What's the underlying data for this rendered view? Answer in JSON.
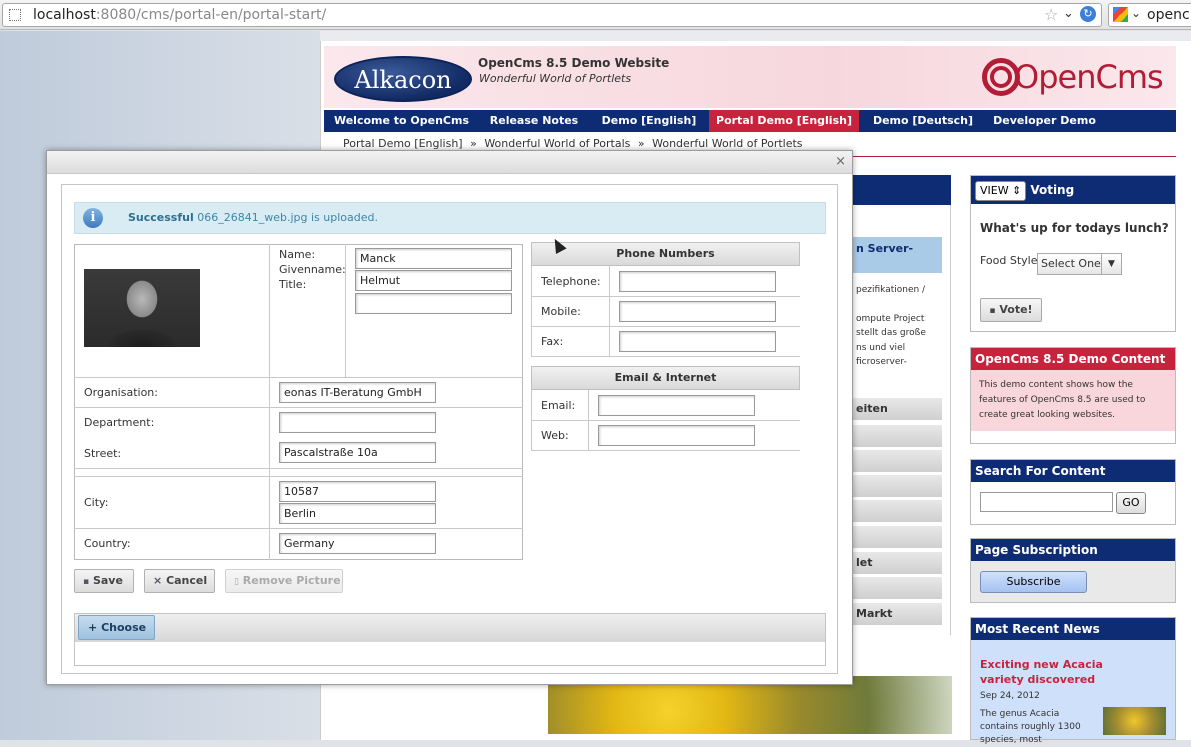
{
  "browser": {
    "url_host": "localhost",
    "url_path": ":8080/cms/portal-en/portal-start/",
    "search_text": "openc"
  },
  "site": {
    "brand": "Alkacon",
    "title": "OpenCms 8.5 Demo Website",
    "subtitle": "Wonderful World of Portlets",
    "logo_text": "OpenCms",
    "nav": [
      "Welcome to OpenCms",
      "Release Notes",
      "Demo [English]",
      "Portal Demo [English]",
      "Demo [Deutsch]",
      "Developer Demo"
    ],
    "nav_active": "Portal Demo [English]",
    "breadcrumb": [
      "Portal Demo [English]",
      "Wonderful World of Portals",
      "Wonderful World of Portlets"
    ],
    "breadcrumb_sep": "»",
    "colors": {
      "nav": "#0d2c74",
      "accent": "#c8233d"
    }
  },
  "middle": {
    "blue_label": "n Server-",
    "lines": [
      "pezifikationen /",
      "ompute Project",
      "stellt das große",
      "ns und viel",
      "ficroserver-"
    ],
    "grey_items": [
      "eiten",
      "",
      "",
      "",
      "",
      "",
      "let",
      "",
      "Markt"
    ]
  },
  "sidebar": {
    "voting": {
      "view_select": "VIEW",
      "title": "Voting",
      "question": "What's up for todays lunch?",
      "food_label": "Food Style:",
      "food_select": "Select One",
      "vote_button": "Vote!"
    },
    "demo": {
      "title": "OpenCms 8.5 Demo Content",
      "text": "This demo content shows how the features of OpenCms 8.5 are used to create great looking websites."
    },
    "search": {
      "title": "Search For Content",
      "go": "GO"
    },
    "subscription": {
      "title": "Page Subscription",
      "button": "Subscribe"
    },
    "news": {
      "title": "Most Recent News",
      "headline": "Exciting new Acacia variety discovered",
      "date": "Sep 24, 2012",
      "text": "The genus Acacia contains roughly 1300 species, most"
    }
  },
  "dialog": {
    "close": "×",
    "info": {
      "status": "Successful",
      "message": "066_26841_web.jpg is uploaded."
    },
    "name_labels": {
      "name": "Name:",
      "givenname": "Givenname:",
      "title": "Title:"
    },
    "fields": {
      "name": "Manck",
      "givenname": "Helmut",
      "title": "",
      "organisation_label": "Organisation:",
      "organisation": "eonas IT-Beratung GmbH",
      "department_label": "Department:",
      "department": "",
      "street_label": "Street:",
      "street": "Pascalstraße 10a",
      "city_label": "City:",
      "zip": "10587",
      "city": "Berlin",
      "country_label": "Country:",
      "country": "Germany"
    },
    "phone": {
      "title": "Phone Numbers",
      "telephone_label": "Telephone:",
      "telephone": "",
      "mobile_label": "Mobile:",
      "mobile": "",
      "fax_label": "Fax:",
      "fax": ""
    },
    "internet": {
      "title": "Email & Internet",
      "email_label": "Email:",
      "email": "",
      "web_label": "Web:",
      "web": ""
    },
    "buttons": {
      "save": "Save",
      "cancel": "Cancel",
      "remove_picture": "Remove Picture",
      "choose": "Choose"
    }
  }
}
